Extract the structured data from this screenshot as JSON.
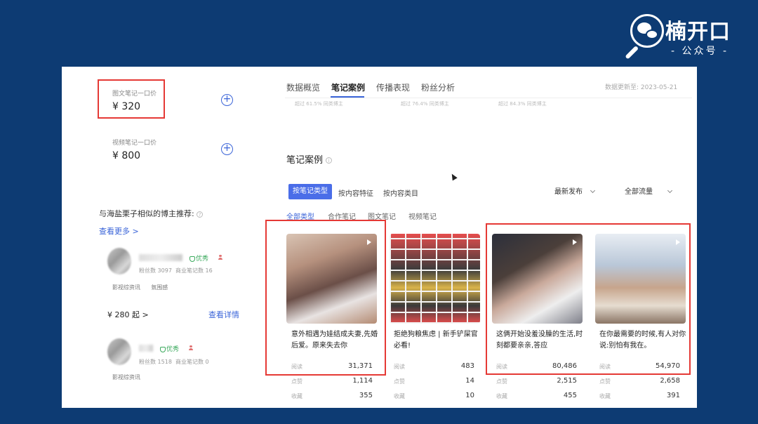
{
  "brand": {
    "name": "楠开口",
    "subtitle": "- 公众号 -",
    "icon": "magnifier-wechat-icon"
  },
  "left": {
    "image_note": {
      "label": "图文笔记一口价",
      "price": "¥ 320"
    },
    "video_note": {
      "label": "视频笔记一口价",
      "price": "¥ 800"
    },
    "add_icon": "plus-circle-icon",
    "recommend_title": "与海盐栗子相似的博主推荐:",
    "see_more": "查看更多 >",
    "bloggers": [
      {
        "badge": "优秀",
        "fans_label": "粉丝数",
        "fans": "3097",
        "notes_label": "商业笔记数",
        "notes": "16",
        "tags": [
          "影视综资讯",
          "氛围感"
        ],
        "price": "¥ 280 起 >",
        "detail": "查看详情"
      },
      {
        "badge": "优秀",
        "fans_label": "粉丝数",
        "fans": "1518",
        "notes_label": "商业笔记数",
        "notes": "0",
        "tags": [
          "影视综资讯"
        ]
      }
    ]
  },
  "right": {
    "tabs": [
      "数据概览",
      "笔记案例",
      "传播表现",
      "粉丝分析"
    ],
    "active_tab": 1,
    "updated": "数据更新至: 2023-05-21",
    "hints": [
      {
        "pre": "超过",
        "val": "61.5%",
        "post": "同类博主"
      },
      {
        "pre": "超过",
        "val": "76.4%",
        "post": "同类博主"
      },
      {
        "pre": "超过",
        "val": "84.3%",
        "post": "同类博主"
      }
    ],
    "section_title": "笔记案例",
    "filters": [
      "按笔记类型",
      "按内容特征",
      "按内容类目"
    ],
    "sort": "最新发布",
    "flow": "全部流量",
    "subtabs": [
      "全部类型",
      "合作笔记",
      "图文笔记",
      "视频笔记"
    ],
    "cards": [
      {
        "title": "意外相遇为娃结成夫妻,先婚后爱。原来失去你",
        "read": "31,371",
        "like": "1,114",
        "fav": "355",
        "video": true
      },
      {
        "title": "拒绝狗粮焦虑 | 新手铲屎官必看!",
        "read": "483",
        "like": "14",
        "fav": "10",
        "video": false
      },
      {
        "title": "这俩开始没羞没臊的生活,时刻都要亲亲,答应",
        "read": "80,486",
        "like": "2,515",
        "fav": "455",
        "video": true
      },
      {
        "title": "在你最需要的时候,有人对你说:别怕有我在。",
        "read": "54,970",
        "like": "2,658",
        "fav": "391",
        "video": true
      }
    ],
    "metric_labels": {
      "read": "阅读",
      "like": "点赞",
      "fav": "收藏"
    }
  }
}
